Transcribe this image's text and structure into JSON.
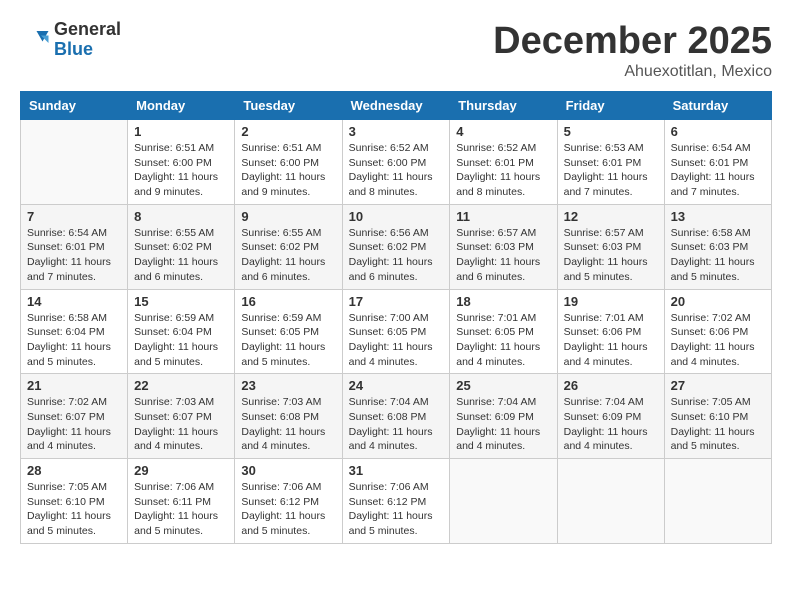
{
  "logo": {
    "general": "General",
    "blue": "Blue"
  },
  "title": "December 2025",
  "location": "Ahuexotitlan, Mexico",
  "headers": [
    "Sunday",
    "Monday",
    "Tuesday",
    "Wednesday",
    "Thursday",
    "Friday",
    "Saturday"
  ],
  "weeks": [
    [
      {
        "day": "",
        "info": ""
      },
      {
        "day": "1",
        "info": "Sunrise: 6:51 AM\nSunset: 6:00 PM\nDaylight: 11 hours\nand 9 minutes."
      },
      {
        "day": "2",
        "info": "Sunrise: 6:51 AM\nSunset: 6:00 PM\nDaylight: 11 hours\nand 9 minutes."
      },
      {
        "day": "3",
        "info": "Sunrise: 6:52 AM\nSunset: 6:00 PM\nDaylight: 11 hours\nand 8 minutes."
      },
      {
        "day": "4",
        "info": "Sunrise: 6:52 AM\nSunset: 6:01 PM\nDaylight: 11 hours\nand 8 minutes."
      },
      {
        "day": "5",
        "info": "Sunrise: 6:53 AM\nSunset: 6:01 PM\nDaylight: 11 hours\nand 7 minutes."
      },
      {
        "day": "6",
        "info": "Sunrise: 6:54 AM\nSunset: 6:01 PM\nDaylight: 11 hours\nand 7 minutes."
      }
    ],
    [
      {
        "day": "7",
        "info": "Sunrise: 6:54 AM\nSunset: 6:01 PM\nDaylight: 11 hours\nand 7 minutes."
      },
      {
        "day": "8",
        "info": "Sunrise: 6:55 AM\nSunset: 6:02 PM\nDaylight: 11 hours\nand 6 minutes."
      },
      {
        "day": "9",
        "info": "Sunrise: 6:55 AM\nSunset: 6:02 PM\nDaylight: 11 hours\nand 6 minutes."
      },
      {
        "day": "10",
        "info": "Sunrise: 6:56 AM\nSunset: 6:02 PM\nDaylight: 11 hours\nand 6 minutes."
      },
      {
        "day": "11",
        "info": "Sunrise: 6:57 AM\nSunset: 6:03 PM\nDaylight: 11 hours\nand 6 minutes."
      },
      {
        "day": "12",
        "info": "Sunrise: 6:57 AM\nSunset: 6:03 PM\nDaylight: 11 hours\nand 5 minutes."
      },
      {
        "day": "13",
        "info": "Sunrise: 6:58 AM\nSunset: 6:03 PM\nDaylight: 11 hours\nand 5 minutes."
      }
    ],
    [
      {
        "day": "14",
        "info": "Sunrise: 6:58 AM\nSunset: 6:04 PM\nDaylight: 11 hours\nand 5 minutes."
      },
      {
        "day": "15",
        "info": "Sunrise: 6:59 AM\nSunset: 6:04 PM\nDaylight: 11 hours\nand 5 minutes."
      },
      {
        "day": "16",
        "info": "Sunrise: 6:59 AM\nSunset: 6:05 PM\nDaylight: 11 hours\nand 5 minutes."
      },
      {
        "day": "17",
        "info": "Sunrise: 7:00 AM\nSunset: 6:05 PM\nDaylight: 11 hours\nand 4 minutes."
      },
      {
        "day": "18",
        "info": "Sunrise: 7:01 AM\nSunset: 6:05 PM\nDaylight: 11 hours\nand 4 minutes."
      },
      {
        "day": "19",
        "info": "Sunrise: 7:01 AM\nSunset: 6:06 PM\nDaylight: 11 hours\nand 4 minutes."
      },
      {
        "day": "20",
        "info": "Sunrise: 7:02 AM\nSunset: 6:06 PM\nDaylight: 11 hours\nand 4 minutes."
      }
    ],
    [
      {
        "day": "21",
        "info": "Sunrise: 7:02 AM\nSunset: 6:07 PM\nDaylight: 11 hours\nand 4 minutes."
      },
      {
        "day": "22",
        "info": "Sunrise: 7:03 AM\nSunset: 6:07 PM\nDaylight: 11 hours\nand 4 minutes."
      },
      {
        "day": "23",
        "info": "Sunrise: 7:03 AM\nSunset: 6:08 PM\nDaylight: 11 hours\nand 4 minutes."
      },
      {
        "day": "24",
        "info": "Sunrise: 7:04 AM\nSunset: 6:08 PM\nDaylight: 11 hours\nand 4 minutes."
      },
      {
        "day": "25",
        "info": "Sunrise: 7:04 AM\nSunset: 6:09 PM\nDaylight: 11 hours\nand 4 minutes."
      },
      {
        "day": "26",
        "info": "Sunrise: 7:04 AM\nSunset: 6:09 PM\nDaylight: 11 hours\nand 4 minutes."
      },
      {
        "day": "27",
        "info": "Sunrise: 7:05 AM\nSunset: 6:10 PM\nDaylight: 11 hours\nand 5 minutes."
      }
    ],
    [
      {
        "day": "28",
        "info": "Sunrise: 7:05 AM\nSunset: 6:10 PM\nDaylight: 11 hours\nand 5 minutes."
      },
      {
        "day": "29",
        "info": "Sunrise: 7:06 AM\nSunset: 6:11 PM\nDaylight: 11 hours\nand 5 minutes."
      },
      {
        "day": "30",
        "info": "Sunrise: 7:06 AM\nSunset: 6:12 PM\nDaylight: 11 hours\nand 5 minutes."
      },
      {
        "day": "31",
        "info": "Sunrise: 7:06 AM\nSunset: 6:12 PM\nDaylight: 11 hours\nand 5 minutes."
      },
      {
        "day": "",
        "info": ""
      },
      {
        "day": "",
        "info": ""
      },
      {
        "day": "",
        "info": ""
      }
    ]
  ]
}
